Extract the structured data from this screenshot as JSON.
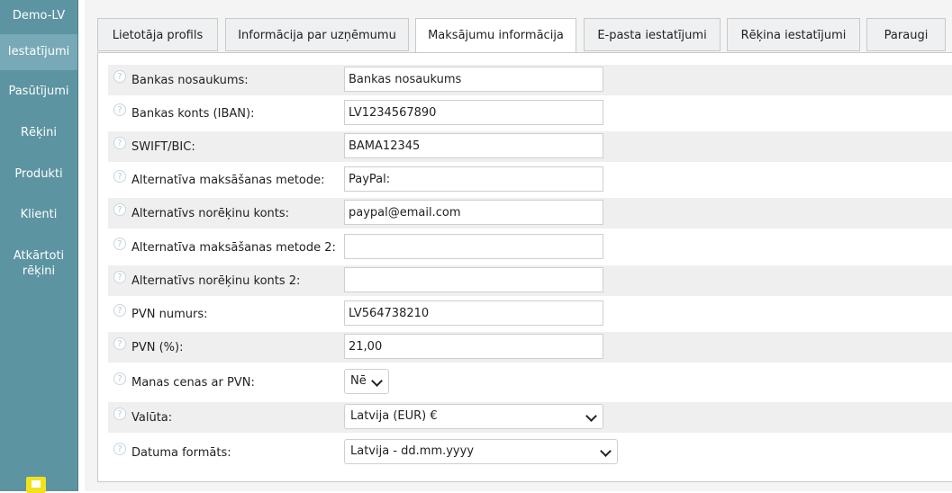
{
  "sidebar": {
    "brand": "Demo-LV",
    "items": [
      {
        "label": "Iestatījumi",
        "active": true
      },
      {
        "label": "Pasūtījumi"
      },
      {
        "label": "Rēķini"
      },
      {
        "label": "Produkti"
      },
      {
        "label": "Klienti"
      },
      {
        "label": "Atkārtoti rēķini"
      }
    ]
  },
  "tabs": [
    {
      "label": "Lietotāja profils"
    },
    {
      "label": "Informācija par uzņēmumu"
    },
    {
      "label": "Maksājumu informācija",
      "active": true
    },
    {
      "label": "E-pasta iestatījumi"
    },
    {
      "label": "Rēķina iestatījumi"
    },
    {
      "label": "Paraugi"
    }
  ],
  "form": {
    "bank_name": {
      "label": "Bankas nosaukums:",
      "value": "Bankas nosaukums"
    },
    "bank_account": {
      "label": "Bankas konts (IBAN):",
      "value": "LV1234567890"
    },
    "swift": {
      "label": "SWIFT/BIC:",
      "value": "BAMA12345"
    },
    "alt_method": {
      "label": "Alternatīva maksāšanas metode:",
      "value": "PayPal:"
    },
    "alt_account": {
      "label": "Alternatīvs norēķinu konts:",
      "value": "paypal@email.com"
    },
    "alt_method2": {
      "label": "Alternatīva maksāšanas metode 2:",
      "value": ""
    },
    "alt_account2": {
      "label": "Alternatīvs norēķinu konts 2:",
      "value": ""
    },
    "vat_number": {
      "label": "PVN numurs:",
      "value": "LV564738210"
    },
    "vat_percent": {
      "label": "PVN (%):",
      "value": "21,00"
    },
    "prices_with_vat": {
      "label": "Manas cenas ar PVN:",
      "value": "Nē"
    },
    "currency": {
      "label": "Valūta:",
      "value": "Latvija (EUR) €"
    },
    "date_format": {
      "label": "Datuma formāts:",
      "value": "Latvija - dd.mm.yyyy"
    }
  },
  "icons": {
    "help": "question-circle-icon",
    "help_glyph": "?"
  },
  "colors": {
    "sidebar": "#5c94a2",
    "sidebar_active": "#77a9b6",
    "accent_yellow": "#f2e21b"
  }
}
